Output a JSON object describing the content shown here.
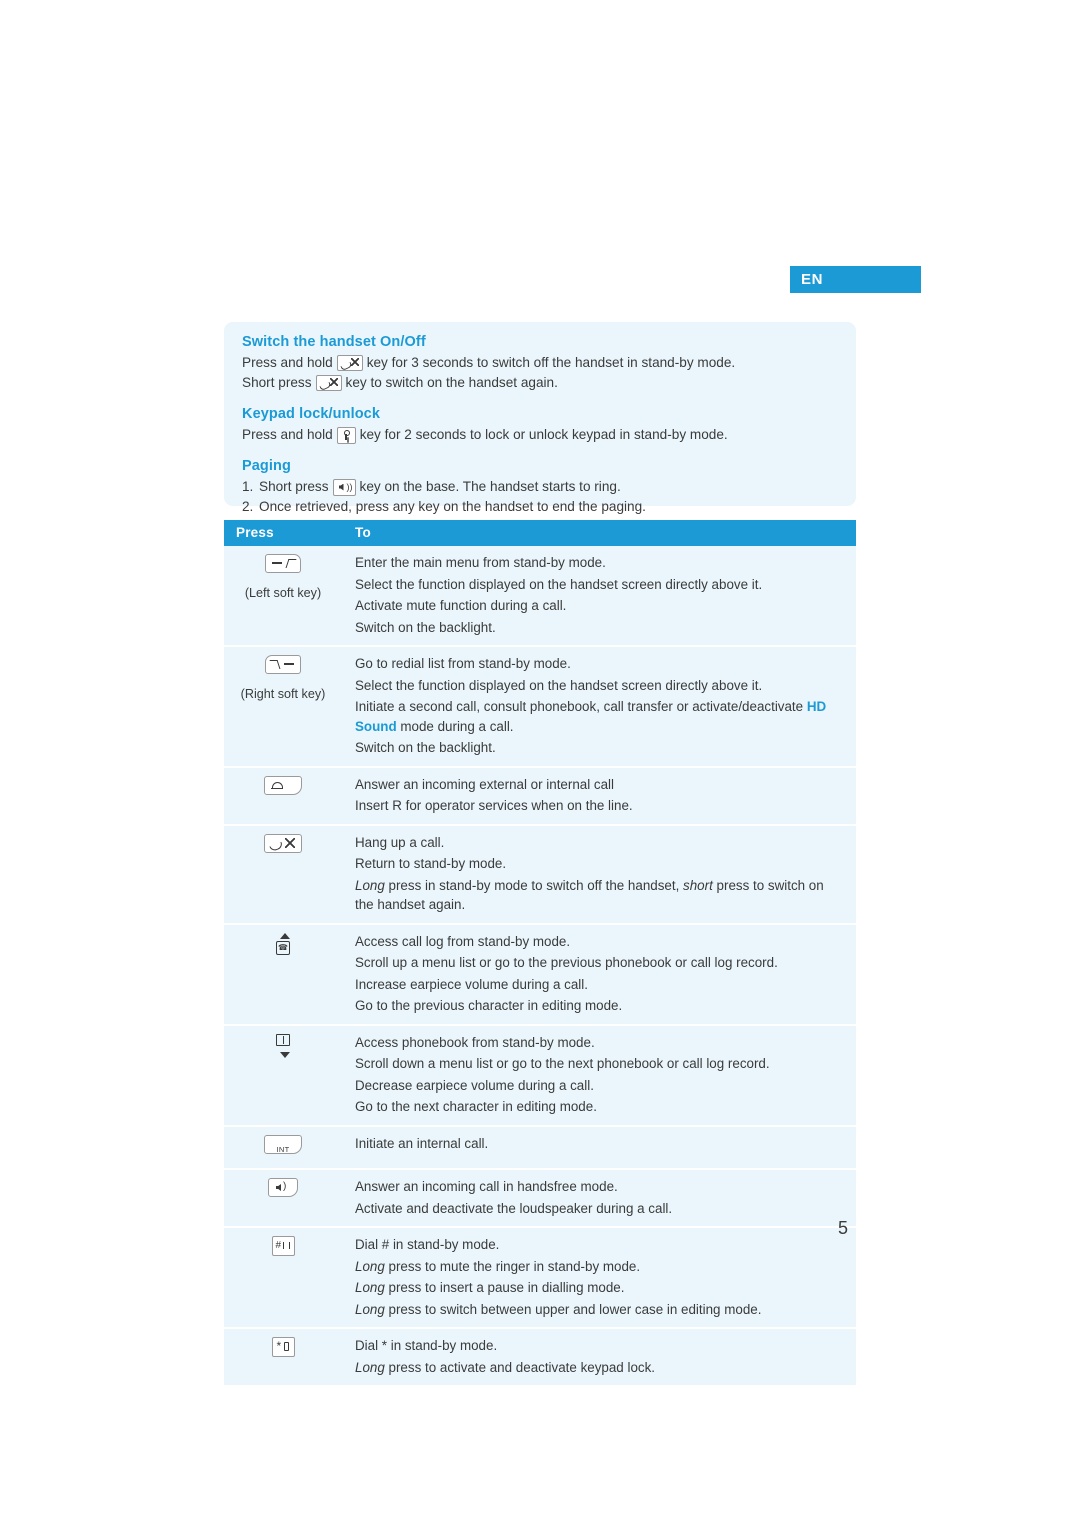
{
  "language_tab": "EN",
  "page_number": "5",
  "info_panel": {
    "sections": [
      {
        "heading": "Switch the handset On/Off",
        "lines": [
          {
            "before": "Press and hold",
            "icon": "hangup-key-icon",
            "after": "key for 3 seconds to switch off the handset in stand-by mode."
          },
          {
            "before": "Short press",
            "icon": "hangup-key-icon",
            "after": "key to switch on the handset again."
          }
        ]
      },
      {
        "heading": "Keypad lock/unlock",
        "lines": [
          {
            "before": "Press and hold",
            "icon": "keypad-lock-icon",
            "after": "key for 2 seconds to lock or unlock keypad in stand-by mode."
          }
        ]
      },
      {
        "heading": "Paging",
        "lines": [
          {
            "num": "1.",
            "before": "Short press",
            "icon": "paging-key-icon",
            "after": "key on the base. The handset starts to ring."
          },
          {
            "num": "2.",
            "before": "Once retrieved, press any key on the handset to end the paging.",
            "icon": "",
            "after": ""
          }
        ]
      }
    ]
  },
  "table": {
    "headers": {
      "press": "Press",
      "to": "To"
    },
    "rows": [
      {
        "key_icon": "left-soft-key-icon",
        "key_caption": "(Left soft key)",
        "actions": [
          "Enter the main menu from stand-by mode.",
          "Select the function displayed on the handset screen directly above it.",
          "Activate mute function during a call.",
          "Switch on the backlight."
        ]
      },
      {
        "key_icon": "right-soft-key-icon",
        "key_caption": "(Right soft key)",
        "actions": [
          "Go to redial list from stand-by mode.",
          "Select the function displayed on the handset screen directly above it.",
          "Initiate a second call, consult phonebook, call transfer or activate/deactivate HD Sound mode during a call.",
          "Switch on the backlight."
        ],
        "highlight": "HD Sound"
      },
      {
        "key_icon": "talk-key-icon",
        "key_caption": "",
        "actions": [
          "Answer an incoming external or internal call",
          "Insert R for operator services when on the line."
        ]
      },
      {
        "key_icon": "hangup-key-icon",
        "key_caption": "",
        "actions": [
          "Hang up a call.",
          "Return to stand-by mode.",
          "Long press in stand-by mode to switch off the handset, short press to switch on the handset again."
        ],
        "italic_runs": [
          "Long",
          "short"
        ]
      },
      {
        "key_icon": "up-call-log-key-icon",
        "key_caption": "",
        "actions": [
          "Access call log from stand-by mode.",
          "Scroll up a menu list or go to the previous phonebook or call log record.",
          "Increase earpiece volume during a call.",
          "Go to the previous character in editing mode."
        ]
      },
      {
        "key_icon": "down-phonebook-key-icon",
        "key_caption": "",
        "actions": [
          "Access phonebook from stand-by mode.",
          "Scroll down a menu list or go to the next phonebook or call log record.",
          "Decrease earpiece volume during a call.",
          "Go to the next character in editing mode."
        ]
      },
      {
        "key_icon": "intercom-key-icon",
        "key_caption": "",
        "actions": [
          "Initiate an internal call."
        ]
      },
      {
        "key_icon": "speakerphone-key-icon",
        "key_caption": "",
        "actions": [
          "Answer an incoming call in handsfree mode.",
          "Activate and deactivate the loudspeaker during a call."
        ]
      },
      {
        "key_icon": "hash-key-icon",
        "key_caption": "",
        "actions": [
          "Dial # in stand-by mode.",
          "Long press to mute the ringer in stand-by mode.",
          "Long press to insert a pause in dialling mode.",
          "Long press to switch between upper and lower case in editing mode."
        ],
        "italic_prefix": "Long"
      },
      {
        "key_icon": "star-key-icon",
        "key_caption": "",
        "actions": [
          "Dial * in stand-by mode.",
          "Long press to activate and deactivate keypad lock."
        ],
        "italic_prefix": "Long"
      }
    ]
  }
}
